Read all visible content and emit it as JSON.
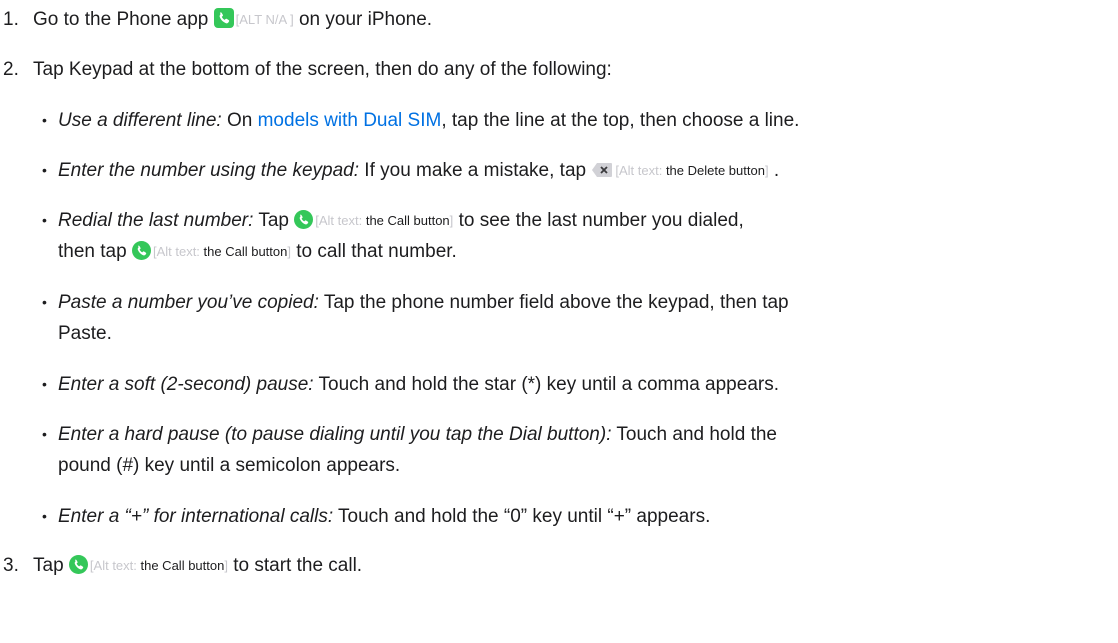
{
  "steps": [
    {
      "number": "1.",
      "before": "Go to the Phone app ",
      "alt": "[ALT N/A ]",
      "after": " on your iPhone."
    },
    {
      "number": "2.",
      "text": "Tap Keypad at the bottom of the screen, then do any of the following:"
    },
    {
      "number": "3.",
      "before": "Tap ",
      "alt_prefix": "[Alt text: ",
      "alt_value": "the Call button",
      "alt_suffix": "]",
      "after": " to start the call."
    }
  ],
  "bullets": {
    "b1": {
      "title": "Use a different line:",
      "before": " On ",
      "link": "models with Dual SIM",
      "after": ", tap the line at the top, then choose a line."
    },
    "b2": {
      "title": "Enter the number using the keypad:",
      "before": " If you make a mistake, tap ",
      "alt_prefix": "[Alt text: ",
      "alt_value": "the Delete button",
      "alt_suffix": "]",
      "after": " ."
    },
    "b3": {
      "title": "Redial the last number:",
      "before": " Tap ",
      "alt_prefix": "[Alt text: ",
      "alt_value": "the Call button",
      "alt_suffix": "]",
      "after": " to see the last number you dialed,",
      "line2_before": "then tap ",
      "line2_after": " to call that number."
    },
    "b4": {
      "title": "Paste a number you’ve copied:",
      "text": " Tap the phone number field above the keypad, then tap",
      "line2": "Paste."
    },
    "b5": {
      "title": "Enter a soft (2-second) pause:",
      "text": " Touch and hold the star (*) key until a comma appears."
    },
    "b6": {
      "title": "Enter a hard pause (to pause dialing until you tap the Dial button):",
      "text": " Touch and hold the",
      "line2": "pound (#) key until a semicolon appears."
    },
    "b7": {
      "title": "Enter a “+” for international calls:",
      "text": " Touch and hold the “0” key until “+” appears."
    }
  },
  "bullet_char": "•",
  "icons": {
    "phone_app": "phone-app-icon",
    "call": "call-icon",
    "delete": "delete-icon"
  },
  "colors": {
    "text": "#1d1d1f",
    "link": "#0071e3",
    "alt_text": "#c7c7cc",
    "icon_green": "#34c759"
  }
}
